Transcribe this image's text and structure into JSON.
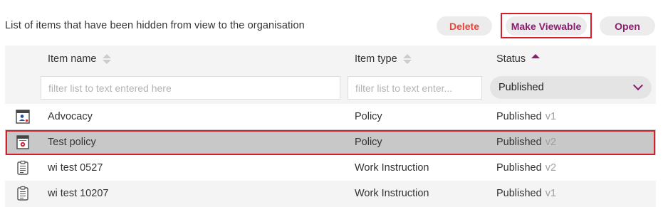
{
  "header": {
    "title": "List of items that have been hidden from view to the organisation",
    "buttons": {
      "delete": "Delete",
      "make_viewable": "Make Viewable",
      "open": "Open"
    }
  },
  "table": {
    "columns": {
      "name": "Item name",
      "type": "Item type",
      "status": "Status"
    },
    "sort": {
      "column": "Status",
      "direction": "ascending"
    },
    "filters": {
      "name_placeholder": "filter list to text entered here",
      "type_placeholder": "filter list to text enter...",
      "status_selected": "Published"
    },
    "rows": [
      {
        "name": "Advocacy",
        "type": "Policy",
        "status": "Published",
        "version": "v1",
        "icon": "policy-user-icon",
        "selected": false
      },
      {
        "name": "Test policy",
        "type": "Policy",
        "status": "Published",
        "version": "v2",
        "icon": "policy-document-icon",
        "selected": true
      },
      {
        "name": "wi test 0527",
        "type": "Work Instruction",
        "status": "Published",
        "version": "v2",
        "icon": "clipboard-icon",
        "selected": false
      },
      {
        "name": "wi test 10207",
        "type": "Work Instruction",
        "status": "Published",
        "version": "v1",
        "icon": "clipboard-icon",
        "selected": false
      }
    ]
  },
  "colors": {
    "accent": "#8e1d71",
    "danger": "#e4473a",
    "highlight": "#d61f2a"
  }
}
